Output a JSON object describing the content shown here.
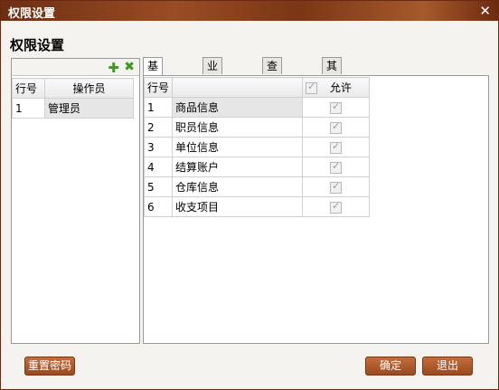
{
  "window": {
    "title": "权限设置",
    "heading": "权限设置"
  },
  "left": {
    "headers": {
      "row_no": "行号",
      "operator": "操作员"
    },
    "rows": [
      {
        "no": "1",
        "name": "管理员"
      }
    ]
  },
  "tabs": [
    "基本资料",
    "业务单据",
    "查询报表",
    "其它"
  ],
  "right": {
    "headers": {
      "row_no": "行号",
      "name": "",
      "allow": "允许"
    },
    "rows": [
      {
        "no": "1",
        "name": "商品信息",
        "allow": true
      },
      {
        "no": "2",
        "name": "职员信息",
        "allow": true
      },
      {
        "no": "3",
        "name": "单位信息",
        "allow": true
      },
      {
        "no": "4",
        "name": "结算账户",
        "allow": true
      },
      {
        "no": "5",
        "name": "仓库信息",
        "allow": true
      },
      {
        "no": "6",
        "name": "收支项目",
        "allow": true
      }
    ]
  },
  "buttons": {
    "reset": "重置密码",
    "ok": "确定",
    "exit": "退出"
  },
  "icons": {
    "add": "plus-icon",
    "delete": "x-icon",
    "close": "close-icon"
  },
  "colors": {
    "titlebar": "#7a3615",
    "button": "#b05a2a",
    "add_icon": "#3a9a1a"
  }
}
